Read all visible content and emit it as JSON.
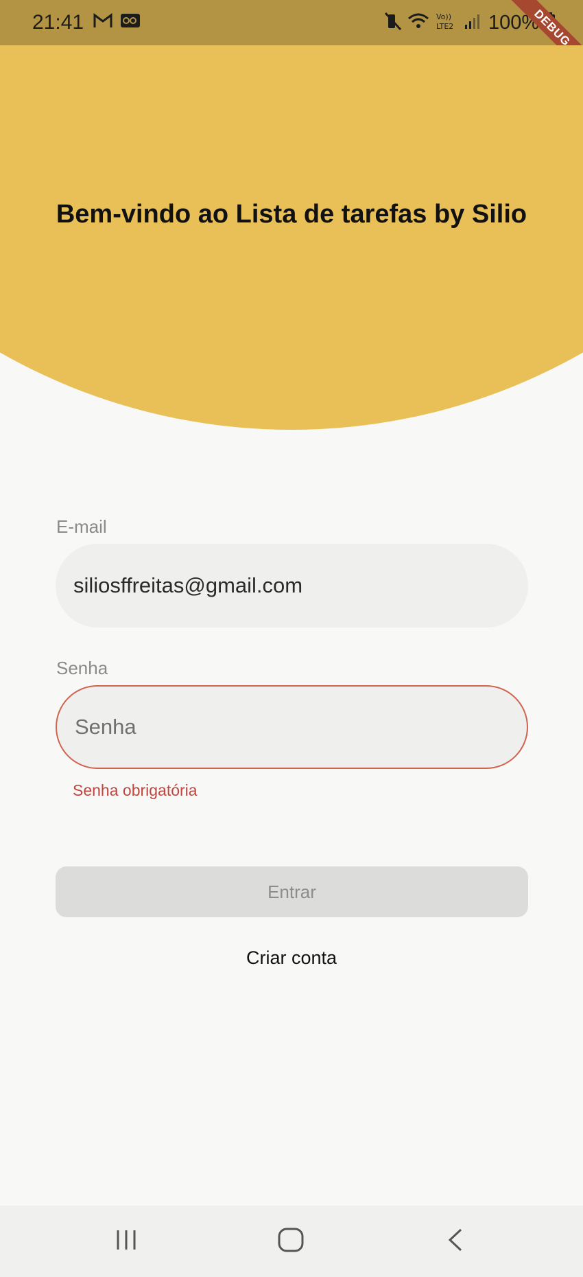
{
  "status_bar": {
    "time": "21:41",
    "left_icons": [
      "gmail-icon",
      "voicemail-icon"
    ],
    "right_icons": [
      "vibrate-mute-icon",
      "wifi-icon",
      "volte-lte2-icon",
      "signal-icon",
      "battery-icon"
    ],
    "battery": "100%"
  },
  "debug_banner": "DEBUG",
  "header": {
    "title": "Bem-vindo ao Lista de tarefas by Silio",
    "color": "#e9bf58"
  },
  "form": {
    "email": {
      "label": "E-mail",
      "value": "siliosffreitas@gmail.com"
    },
    "password": {
      "label": "Senha",
      "placeholder": "Senha",
      "value": "",
      "error": "Senha obrigatória",
      "error_color": "#c2463f"
    },
    "submit_label": "Entrar",
    "create_account_label": "Criar conta"
  },
  "nav_bar": {
    "buttons": [
      "recent-apps-icon",
      "home-icon",
      "back-icon"
    ]
  }
}
